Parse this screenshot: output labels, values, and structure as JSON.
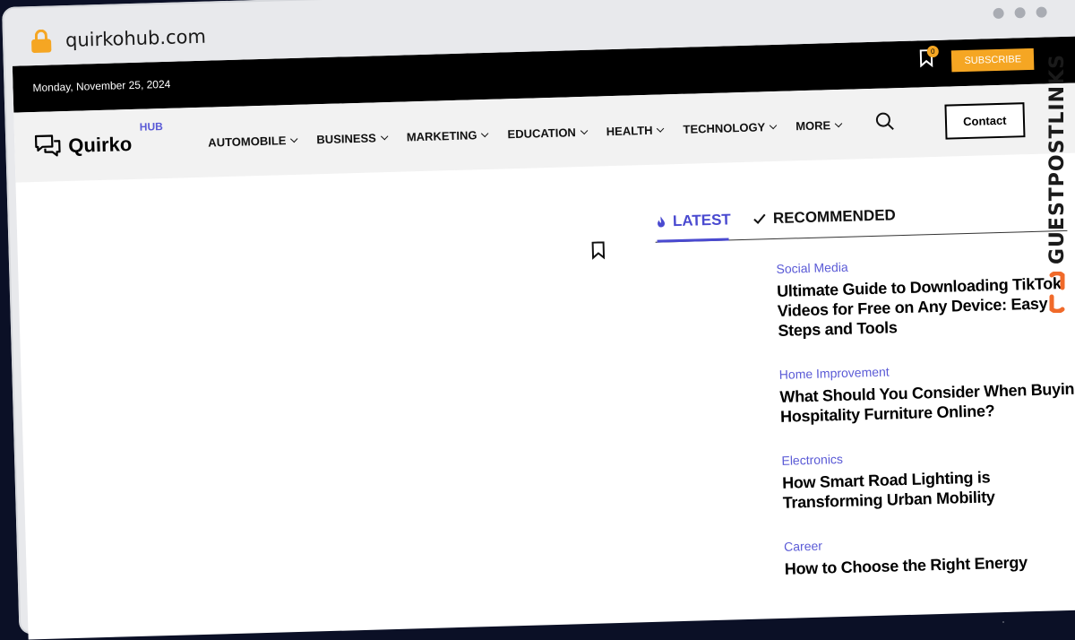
{
  "browser": {
    "url": "quirkohub.com"
  },
  "topbar": {
    "date": "Monday, November 25, 2024",
    "bookmark_count": "0",
    "subscribe_label": "SUBSCRIBE"
  },
  "logo": {
    "name": "Quirko",
    "suffix": "HUB"
  },
  "nav": {
    "items": [
      {
        "label": "AUTOMOBILE"
      },
      {
        "label": "BUSINESS"
      },
      {
        "label": "MARKETING"
      },
      {
        "label": "EDUCATION"
      },
      {
        "label": "HEALTH"
      },
      {
        "label": "TECHNOLOGY"
      },
      {
        "label": "MORE"
      }
    ],
    "contact_label": "Contact"
  },
  "tabs": {
    "latest": "LATEST",
    "recommended": "RECOMMENDED"
  },
  "articles": [
    {
      "category": "Social Media",
      "title": "Ultimate Guide to Downloading TikTok Videos for Free on Any Device: Easy Steps and Tools"
    },
    {
      "category": "Home Improvement",
      "title": "What Should You Consider When Buying Hospitality Furniture Online?"
    },
    {
      "category": "Electronics",
      "title": "How Smart Road Lighting is Transforming Urban Mobility"
    },
    {
      "category": "Career",
      "title": "How to Choose the Right Energy"
    }
  ],
  "watermark": {
    "text": "GUESTPOSTLINKS"
  },
  "colors": {
    "accent": "#5a5ad6",
    "subscribe": "#f5a623",
    "topbar": "#000000"
  }
}
